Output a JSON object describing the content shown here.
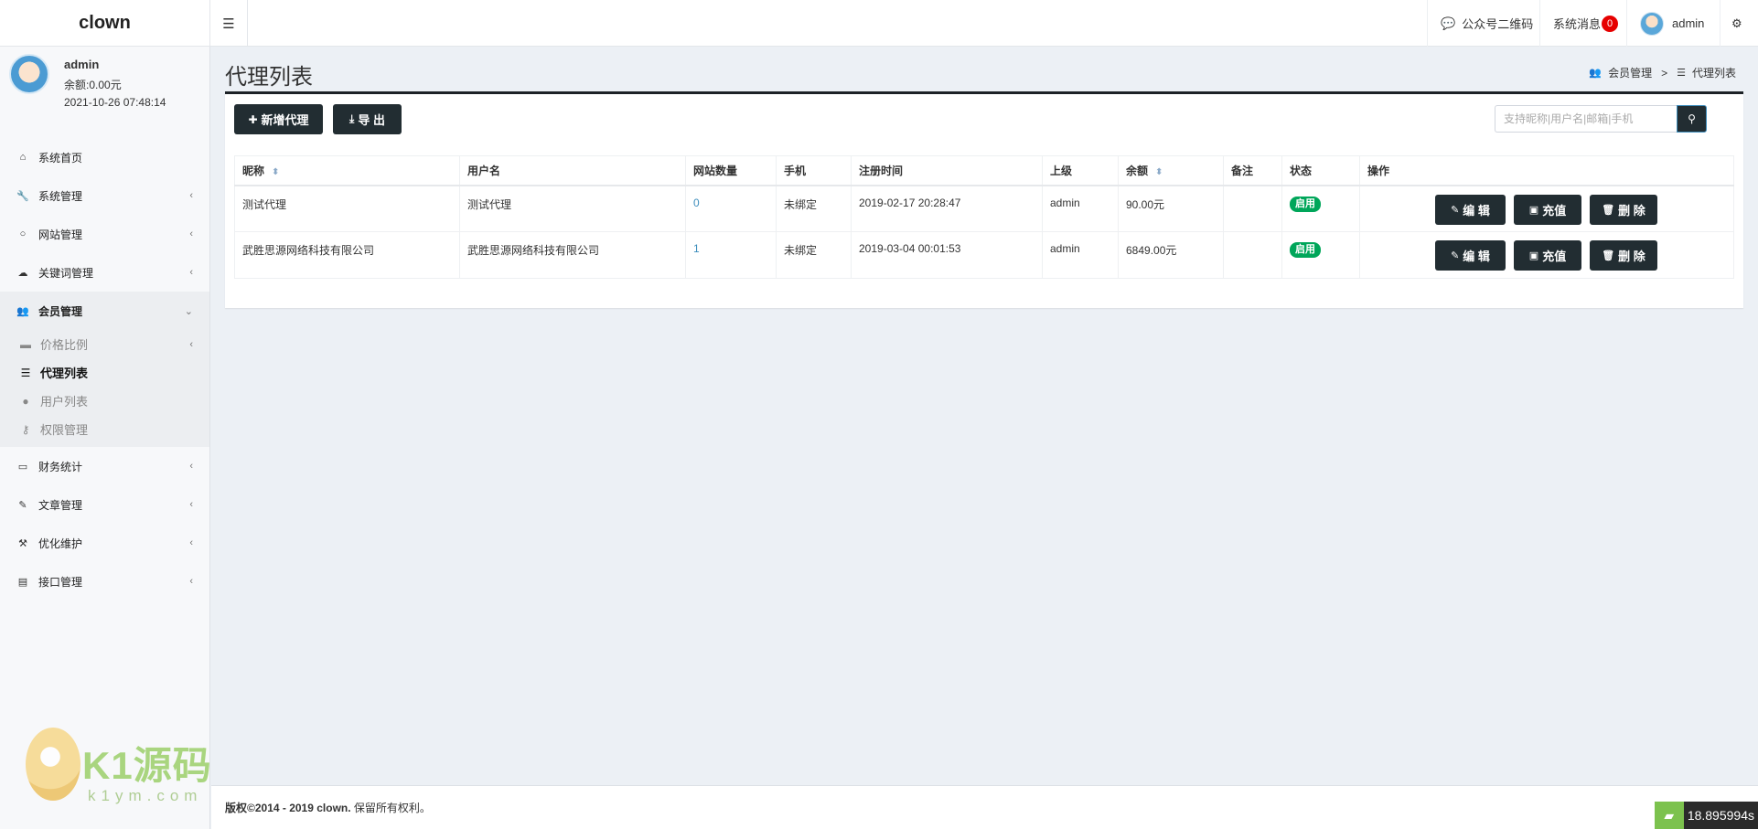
{
  "app": {
    "brand": "clown"
  },
  "topbar": {
    "toggle_icon": "☰",
    "qrcode_label": "公众号二维码",
    "messages_label": "系统消息",
    "messages_count": "0",
    "user_name": "admin"
  },
  "sidebar": {
    "user": {
      "name": "admin",
      "balance": "余额:0.00元",
      "time": "2021-10-26 07:48:14"
    },
    "items": [
      {
        "label": "系统首页",
        "icon": "home-icon"
      },
      {
        "label": "系统管理",
        "icon": "wrench-icon"
      },
      {
        "label": "网站管理",
        "icon": "circle-icon"
      },
      {
        "label": "关键词管理",
        "icon": "cloud-icon"
      },
      {
        "label": "会员管理",
        "icon": "users-icon"
      },
      {
        "label": "财务统计",
        "icon": "credit-card-icon"
      },
      {
        "label": "文章管理",
        "icon": "edit-icon"
      },
      {
        "label": "优化维护",
        "icon": "gavel-icon"
      },
      {
        "label": "接口管理",
        "icon": "book-icon"
      }
    ],
    "submenu": [
      {
        "label": "价格比例",
        "icon": "credit-card-icon"
      },
      {
        "label": "代理列表",
        "icon": "list-icon"
      },
      {
        "label": "用户列表",
        "icon": "user-icon"
      },
      {
        "label": "权限管理",
        "icon": "key-icon"
      }
    ],
    "watermark": {
      "text": "K1源码",
      "sub": "k1ym.com"
    }
  },
  "page": {
    "title": "代理列表",
    "breadcrumb": [
      "会员管理",
      "代理列表"
    ],
    "breadcrumb_sep": ">"
  },
  "toolbar": {
    "add_label": "新增代理",
    "export_label": "导 出",
    "search_placeholder": "支持昵称|用户名|邮箱|手机"
  },
  "table": {
    "columns": [
      "昵称",
      "用户名",
      "网站数量",
      "手机",
      "注册时间",
      "上级",
      "余额",
      "备注",
      "状态",
      "操作"
    ],
    "rows": [
      {
        "nickname": "测试代理",
        "username": "测试代理",
        "sites": "0",
        "phone": "未绑定",
        "reg_time": "2019-02-17 20:28:47",
        "parent": "admin",
        "balance": "90.00元",
        "remark": "",
        "status": "启用"
      },
      {
        "nickname": "武胜思源网络科技有限公司",
        "username": "武胜思源网络科技有限公司",
        "sites": "1",
        "phone": "未绑定",
        "reg_time": "2019-03-04 00:01:53",
        "parent": "admin",
        "balance": "6849.00元",
        "remark": "",
        "status": "启用"
      }
    ],
    "actions": {
      "edit": "编 辑",
      "recharge": "充值",
      "delete": "删 除"
    }
  },
  "footer": {
    "copyright": "版权©2014 - 2019 clown.",
    "rights": "保留所有权利。"
  },
  "timer": "18.895994s"
}
